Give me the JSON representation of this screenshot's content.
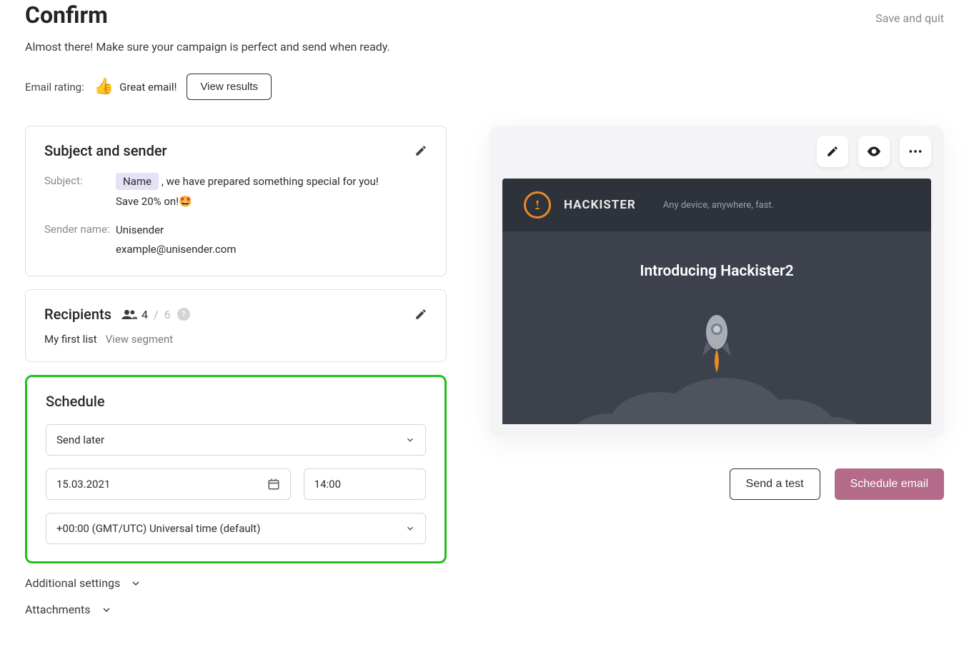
{
  "header": {
    "title": "Confirm",
    "save_quit": "Save and quit",
    "subtitle": "Almost there! Make sure your campaign is perfect and send when ready."
  },
  "rating": {
    "label": "Email rating:",
    "status": "Great email!",
    "view_results": "View results"
  },
  "subject_card": {
    "title": "Subject and sender",
    "subject_label": "Subject:",
    "subject_tag": "Name",
    "subject_text_line1": ", we have prepared something special for you!",
    "subject_text_line2": "Save 20% on!🤩",
    "sender_label": "Sender name:",
    "sender_name": "Unisender",
    "sender_email": "example@unisender.com"
  },
  "recipients_card": {
    "title": "Recipients",
    "active": "4",
    "total": "6",
    "list_name": "My first list",
    "view_segment": "View segment"
  },
  "schedule_card": {
    "title": "Schedule",
    "when": "Send later",
    "date": "15.03.2021",
    "time": "14:00",
    "timezone": "+00:00 (GMT/UTC) Universal time (default)"
  },
  "expand": {
    "additional": "Additional settings",
    "attachments": "Attachments"
  },
  "preview": {
    "brand": "HACKISTER",
    "tagline": "Any device, anywhere, fast.",
    "heading": "Introducing Hackister2"
  },
  "actions": {
    "send_test": "Send a test",
    "schedule": "Schedule email"
  }
}
